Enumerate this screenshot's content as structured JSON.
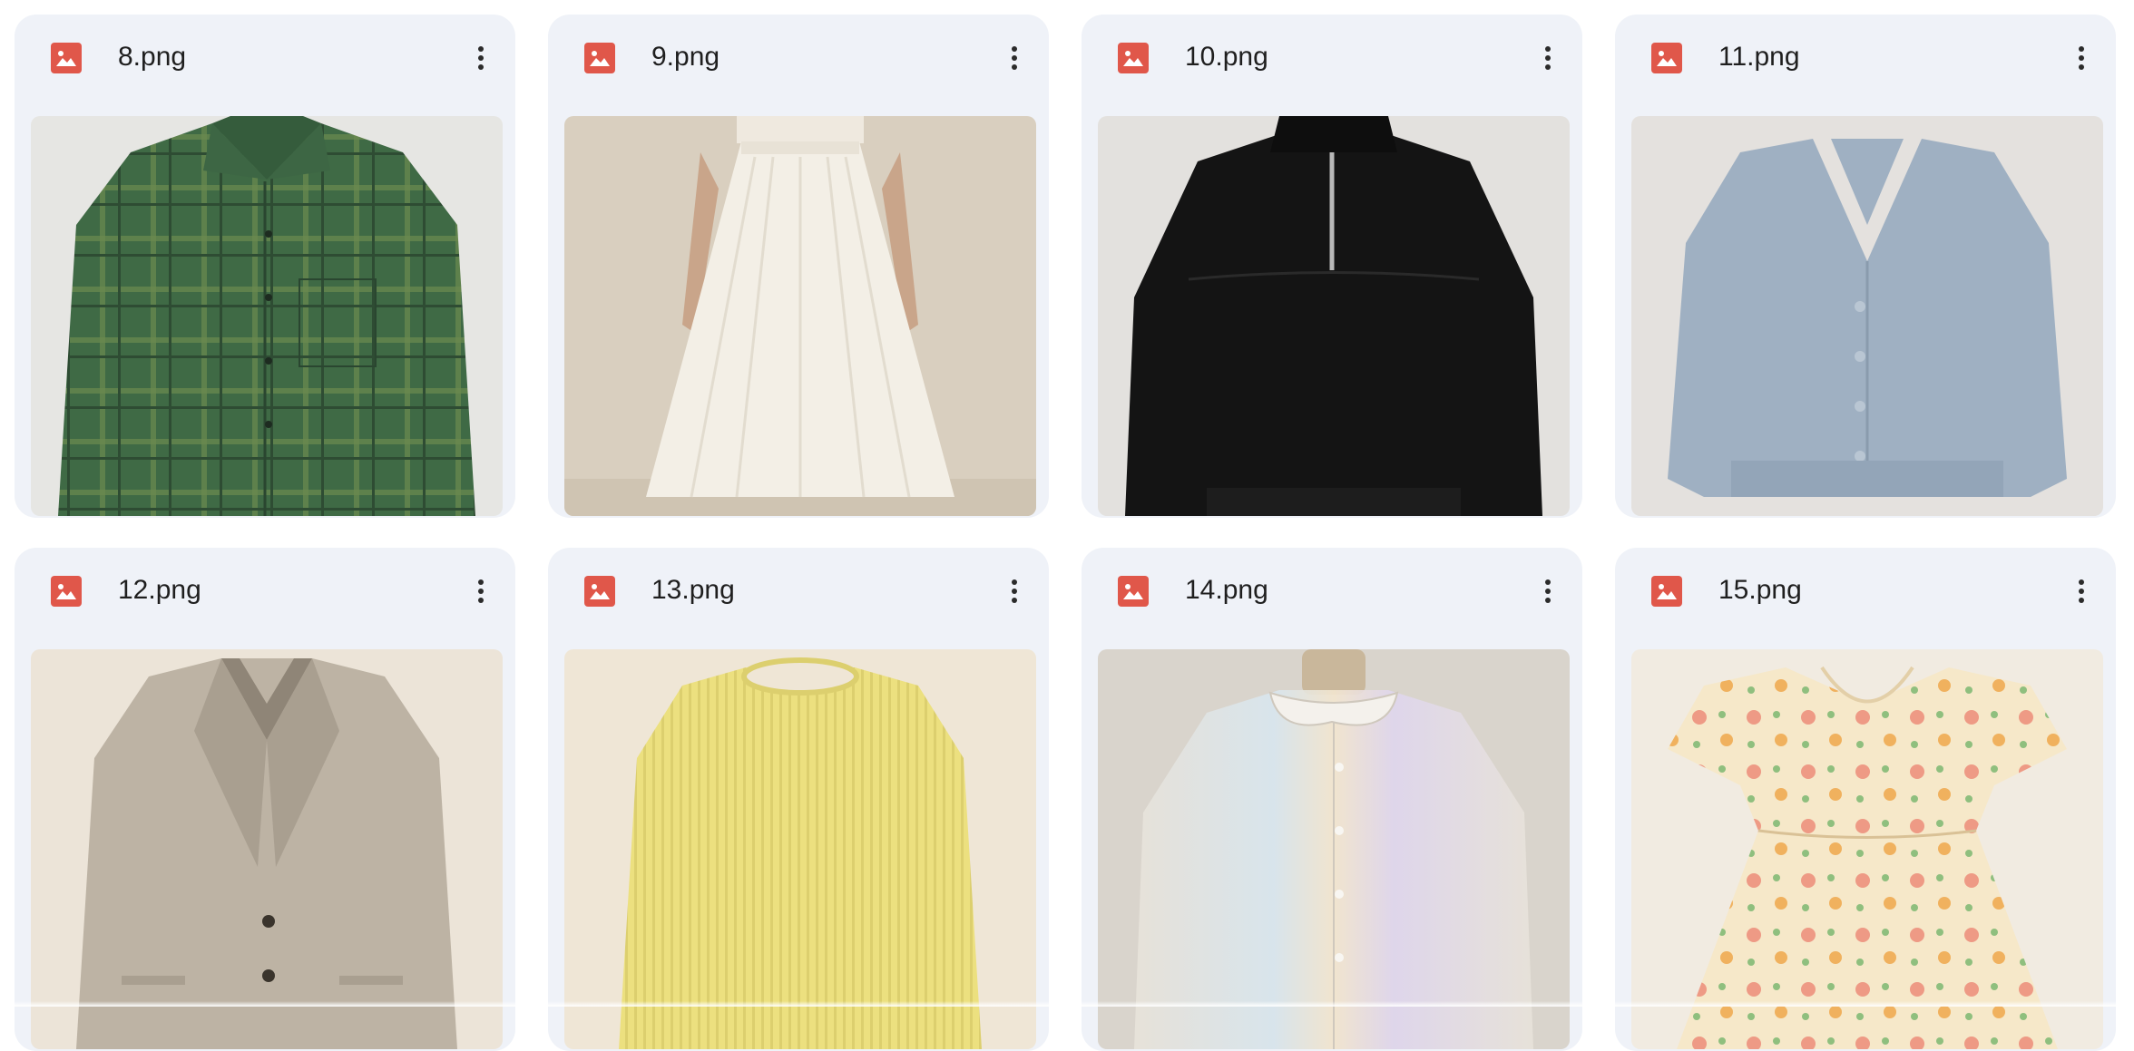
{
  "files": [
    {
      "name": "8.png",
      "type_icon": "image-file-icon",
      "menu_icon": "more-vert-icon",
      "thumbnail": "green plaid shirt"
    },
    {
      "name": "9.png",
      "type_icon": "image-file-icon",
      "menu_icon": "more-vert-icon",
      "thumbnail": "white maxi skirt"
    },
    {
      "name": "10.png",
      "type_icon": "image-file-icon",
      "menu_icon": "more-vert-icon",
      "thumbnail": "black velvet half-zip pullover"
    },
    {
      "name": "11.png",
      "type_icon": "image-file-icon",
      "menu_icon": "more-vert-icon",
      "thumbnail": "light blue knit cardigan"
    },
    {
      "name": "12.png",
      "type_icon": "image-file-icon",
      "menu_icon": "more-vert-icon",
      "thumbnail": "beige blazer"
    },
    {
      "name": "13.png",
      "type_icon": "image-file-icon",
      "menu_icon": "more-vert-icon",
      "thumbnail": "pale yellow ribbed sweater"
    },
    {
      "name": "14.png",
      "type_icon": "image-file-icon",
      "menu_icon": "more-vert-icon",
      "thumbnail": "iridescent blouse on mannequin"
    },
    {
      "name": "15.png",
      "type_icon": "image-file-icon",
      "menu_icon": "more-vert-icon",
      "thumbnail": "floral summer dress"
    }
  ],
  "colors": {
    "card_background": "#eff2f8",
    "image_icon": "#e0574a",
    "text": "#1f1f1f"
  }
}
